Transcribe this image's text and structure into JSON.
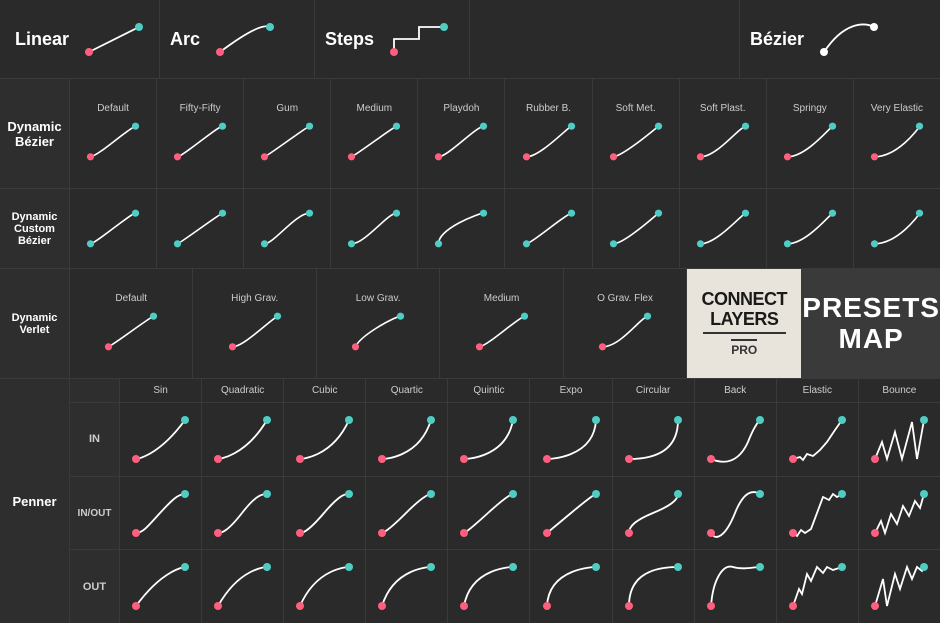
{
  "rows": {
    "row1_label": "Linear",
    "row1_sections": [
      "Linear",
      "Arc",
      "Steps",
      "Bézier"
    ],
    "row2_label": "Dynamic\nBézier",
    "row2_presets": [
      "Default",
      "Fifty-Fifty",
      "Gum",
      "Medium",
      "Playdoh",
      "Rubber B.",
      "Soft Met.",
      "Soft Plast.",
      "Springy",
      "Very Elastic"
    ],
    "row3_label": "Dynamic\nCustom\nBézier",
    "row3_presets": [
      "",
      "",
      "",
      "",
      "",
      "",
      "",
      "",
      "",
      ""
    ],
    "row4_label": "Dynamic\nVerlet",
    "row4_presets": [
      "Default",
      "High Grav.",
      "Low Grav.",
      "Medium",
      "O Grav. Flex"
    ],
    "logo_main": "CONNECT\nLAYERS",
    "logo_sub": "PRO",
    "presets_map": "PRESETS\nMAP",
    "penner_label": "Penner",
    "penner_types": [
      "Sin",
      "Quadratic",
      "Cubic",
      "Quartic",
      "Quintic",
      "Expo",
      "Circular",
      "Back",
      "Elastic",
      "Bounce"
    ],
    "penner_sub_labels": [
      "IN",
      "IN/OUT",
      "OUT"
    ]
  }
}
